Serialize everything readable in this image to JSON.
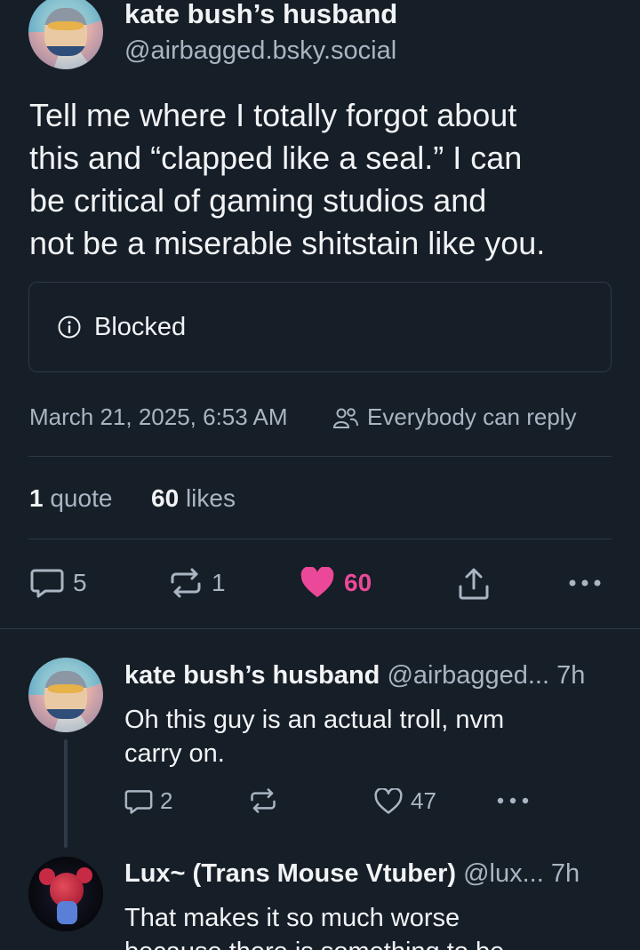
{
  "main_post": {
    "author_name": "kate bush’s husband",
    "author_handle": "@airbagged.bsky.social",
    "text_lines": [
      "Tell me where I totally forgot about",
      "this and “clapped like a seal.”  I can",
      "be critical of gaming studios and",
      "not be a miserable shitstain like you."
    ],
    "embed_label": "Blocked",
    "timestamp": "March 21, 2025, 6:53 AM",
    "reply_permission": "Everybody can reply",
    "quotes_count": "1",
    "quotes_label": "quote",
    "likes_count": "60",
    "likes_label": "likes",
    "actions": {
      "replies": "5",
      "reposts": "1",
      "likes": "60"
    }
  },
  "replies": [
    {
      "author_name": "kate bush’s husband",
      "author_handle": "@airbagged...",
      "time": "7h",
      "text_lines": [
        "Oh this guy is an actual troll, nvm",
        "carry on."
      ],
      "reply_count": "2",
      "like_count": "47"
    },
    {
      "author_name": "Lux~ (Trans Mouse Vtuber)",
      "author_handle": "@lux...",
      "time": "7h",
      "text_lines": [
        "That makes it so much worse",
        "because there is something to be"
      ]
    }
  ],
  "colors": {
    "background": "#161e27",
    "text": "#f1f3f5",
    "muted": "#a9b5c3",
    "border": "#2e3a47",
    "like_pink": "#ec4899"
  }
}
